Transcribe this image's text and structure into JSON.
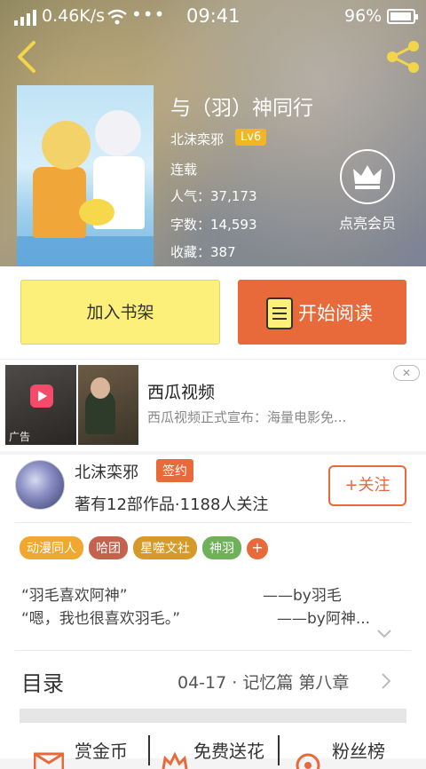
{
  "status_bar": {
    "net_speed": "0.46K/s",
    "more": "•••",
    "time": "09:41",
    "battery": "96%"
  },
  "book": {
    "title": "与（羽）神同行",
    "author": "北沫栾邪",
    "level": "Lv6",
    "status": "连载",
    "popularity": "人气：37,173",
    "word_count": "字数：14,593",
    "favorites": "收藏：387"
  },
  "vip": {
    "label": "点亮会员"
  },
  "actions": {
    "add_shelf": "加入书架",
    "start_read": "开始阅读"
  },
  "ad": {
    "title": "西瓜视频",
    "desc": "西瓜视频正式宣布：海量电影免...",
    "tag": "广告",
    "close": "✕"
  },
  "author": {
    "name": "北沫栾邪",
    "sign": "签约",
    "meta": "著有12部作品·1188人关注",
    "follow": "+关注"
  },
  "tags": [
    {
      "label": "动漫同人",
      "color": "#f0a830"
    },
    {
      "label": "哈团",
      "color": "#c4624d"
    },
    {
      "label": "星噬文社",
      "color": "#d49a2a"
    },
    {
      "label": "神羽",
      "color": "#6fb05a"
    }
  ],
  "tag_add": "+",
  "quotes": [
    {
      "text": "“羽毛喜欢阿神”",
      "by": "——by羽毛"
    },
    {
      "text": "“嗯，我也很喜欢羽毛。”",
      "by": "——by阿神..."
    }
  ],
  "toc": {
    "label": "目录",
    "latest": "04-17 · 记忆篇 第八章"
  },
  "bottom": {
    "reward": "赏金币",
    "flower": "免费送花",
    "fans": "粉丝榜"
  },
  "colors": {
    "accent": "#e8693a",
    "shelf_yellow": "#fdf07a",
    "level_gold": "#f0b623"
  }
}
